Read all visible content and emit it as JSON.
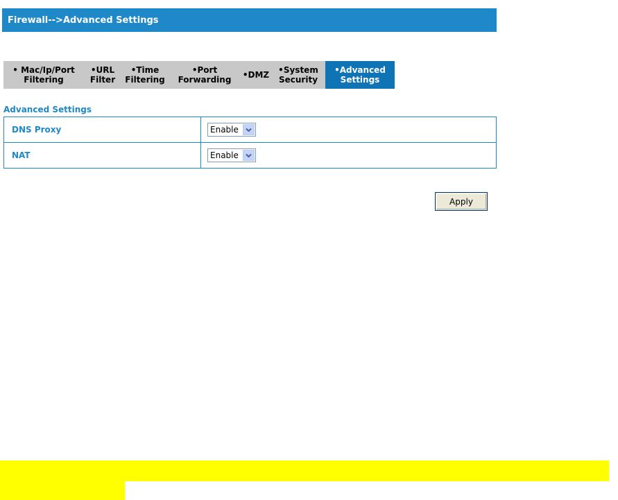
{
  "header": {
    "title": "Firewall-->Advanced Settings"
  },
  "tabs": [
    {
      "line1": "• Mac/Ip/Port",
      "line2": "Filtering"
    },
    {
      "line1": "•URL",
      "line2": "Filter"
    },
    {
      "line1": "•Time",
      "line2": "Filtering"
    },
    {
      "line1": "•Port",
      "line2": "Forwarding"
    },
    {
      "line1": "•DMZ",
      "line2": ""
    },
    {
      "line1": "•System",
      "line2": "Security"
    },
    {
      "line1": "•Advanced",
      "line2": "Settings"
    }
  ],
  "section": {
    "title": "Advanced Settings"
  },
  "settings": [
    {
      "label": "DNS Proxy",
      "value": "Enable"
    },
    {
      "label": "NAT",
      "value": "Enable"
    }
  ],
  "buttons": {
    "apply": "Apply"
  },
  "colors": {
    "accent": "#1e88c8",
    "active_tab": "#0f74b6",
    "tab_background": "#c8c8c8",
    "highlight": "#ffff00"
  },
  "icons": {
    "select_arrow": "chevron-down-icon"
  }
}
